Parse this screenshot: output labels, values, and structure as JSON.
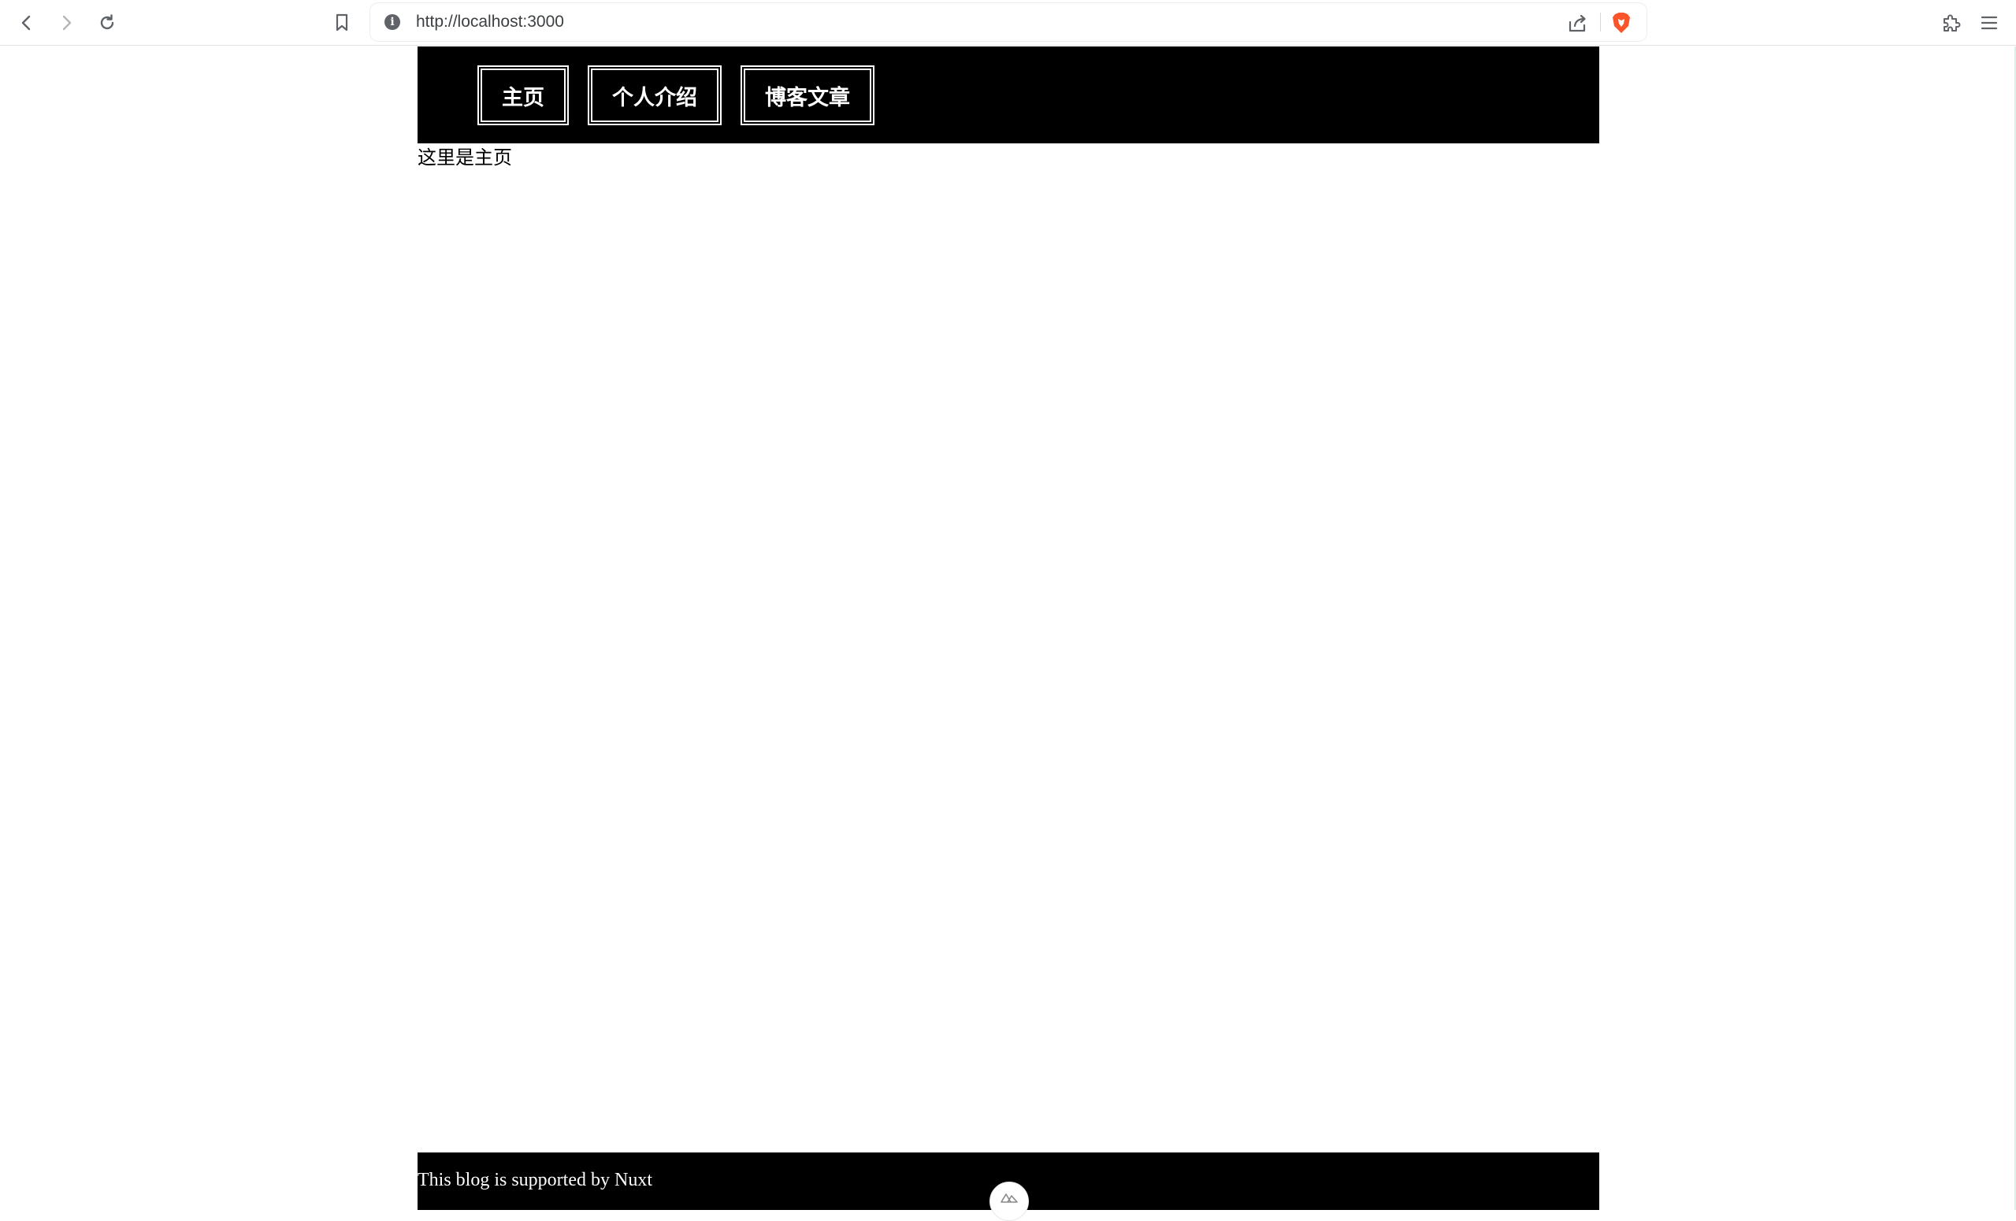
{
  "browser": {
    "url": "http://localhost:3000",
    "icons": {
      "back": "arrow-left-icon",
      "forward": "arrow-right-icon",
      "reload": "reload-icon",
      "bookmark": "bookmark-icon",
      "site_info": "info-icon",
      "share": "share-icon",
      "brave": "brave-lion-icon",
      "extensions": "puzzle-icon",
      "menu": "hamburger-menu-icon"
    },
    "brave_color": "#fb542b"
  },
  "header": {
    "nav": [
      {
        "label": "主页"
      },
      {
        "label": "个人介绍"
      },
      {
        "label": "博客文章"
      }
    ],
    "background": "#000000"
  },
  "main": {
    "text": "这里是主页"
  },
  "footer": {
    "text": "This blog is supported by Nuxt",
    "background": "#000000"
  },
  "devtools": {
    "icon": "nuxt-logo-icon"
  }
}
